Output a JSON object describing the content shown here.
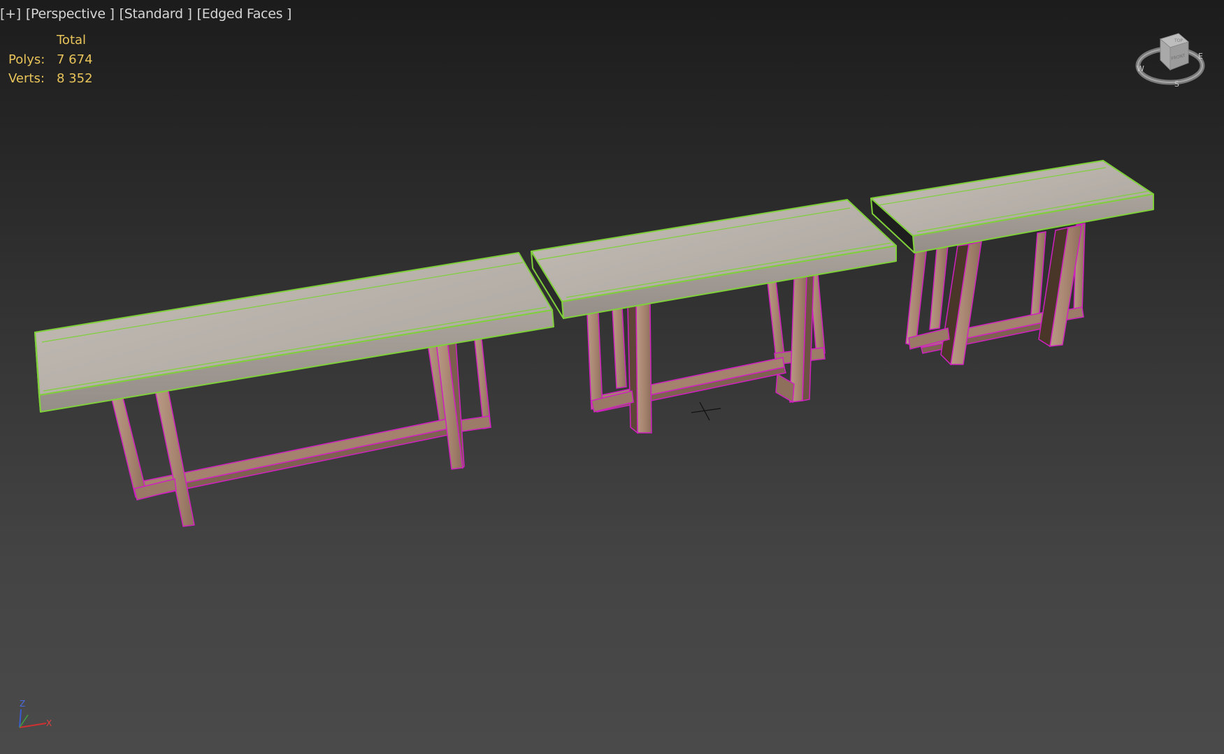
{
  "viewport": {
    "menus": [
      {
        "label": "[+]"
      },
      {
        "label": "[Perspective ]"
      },
      {
        "label": "[Standard ]"
      },
      {
        "label": "[Edged Faces ]"
      }
    ],
    "stats": {
      "header": "Total",
      "rows": [
        {
          "label": "Polys:",
          "value": "7 674"
        },
        {
          "label": "Verts:",
          "value": "8 352"
        }
      ]
    },
    "viewcube": {
      "face_top": "TOP",
      "face_front": "FRONT",
      "compass": [
        "W",
        "S",
        "E"
      ]
    },
    "axis": {
      "z": "Z",
      "x": "X"
    }
  },
  "colors": {
    "selection_edge_top": "#7fd03a",
    "selection_edge_legs": "#d020c0",
    "tabletop": "#b8b2ab",
    "legs": "#b08b74",
    "stats_text": "#e8c45a",
    "label_text": "#d6d6d6"
  },
  "icons": [
    "viewcube-icon",
    "axis-tripod-icon",
    "crosshair-cursor-icon"
  ]
}
